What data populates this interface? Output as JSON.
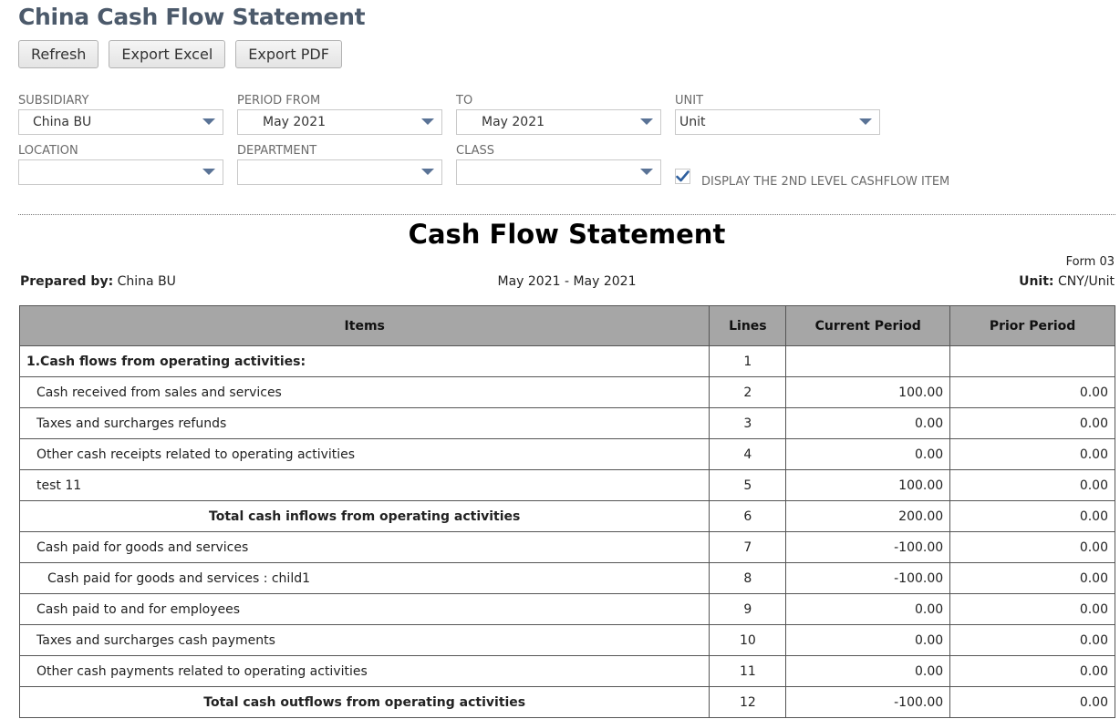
{
  "page": {
    "title": "China Cash Flow Statement"
  },
  "toolbar": {
    "refresh_label": "Refresh",
    "export_excel_label": "Export Excel",
    "export_pdf_label": "Export PDF"
  },
  "filters": {
    "subsidiary": {
      "label": "SUBSIDIARY",
      "value": "China BU"
    },
    "period_from": {
      "label": "PERIOD FROM",
      "value": "May 2021"
    },
    "to": {
      "label": "TO",
      "value": "May 2021"
    },
    "unit": {
      "label": "UNIT",
      "value": "Unit"
    },
    "location": {
      "label": "LOCATION",
      "value": ""
    },
    "department": {
      "label": "DEPARTMENT",
      "value": ""
    },
    "class": {
      "label": "CLASS",
      "value": ""
    },
    "second_level": {
      "label": "DISPLAY THE 2ND LEVEL CASHFLOW ITEM",
      "checked": true
    }
  },
  "report": {
    "title": "Cash Flow Statement",
    "form_no": "Form 03",
    "prepared_by_label": "Prepared by:",
    "prepared_by": "China BU",
    "period": "May 2021 - May 2021",
    "unit_label": "Unit:",
    "unit": "CNY/Unit",
    "headers": {
      "items": "Items",
      "lines": "Lines",
      "current": "Current Period",
      "prior": "Prior Period"
    },
    "rows": [
      {
        "item": "1.Cash flows from operating activities:",
        "line": "1",
        "current": "",
        "prior": ""
      },
      {
        "item": "Cash received from sales and services",
        "line": "2",
        "current": "100.00",
        "prior": "0.00"
      },
      {
        "item": "Taxes and surcharges refunds",
        "line": "3",
        "current": "0.00",
        "prior": "0.00"
      },
      {
        "item": "Other cash receipts related to operating activities",
        "line": "4",
        "current": "0.00",
        "prior": "0.00"
      },
      {
        "item": "test 11",
        "line": "5",
        "current": "100.00",
        "prior": "0.00"
      },
      {
        "item": "Total cash inflows from operating activities",
        "line": "6",
        "current": "200.00",
        "prior": "0.00"
      },
      {
        "item": "Cash paid for goods and services",
        "line": "7",
        "current": "-100.00",
        "prior": "0.00"
      },
      {
        "item": "Cash paid for goods and services : child1",
        "line": "8",
        "current": "-100.00",
        "prior": "0.00"
      },
      {
        "item": "Cash paid to and for employees",
        "line": "9",
        "current": "0.00",
        "prior": "0.00"
      },
      {
        "item": "Taxes and surcharges cash payments",
        "line": "10",
        "current": "0.00",
        "prior": "0.00"
      },
      {
        "item": "Other cash payments related to operating activities",
        "line": "11",
        "current": "0.00",
        "prior": "0.00"
      },
      {
        "item": "Total cash outflows from operating activities",
        "line": "12",
        "current": "-100.00",
        "prior": "0.00"
      }
    ]
  },
  "colors": {
    "title": "#4c5a6b",
    "header_bg": "#a6a6a6",
    "caret": "#5a7396",
    "check": "#2e5f9e"
  }
}
